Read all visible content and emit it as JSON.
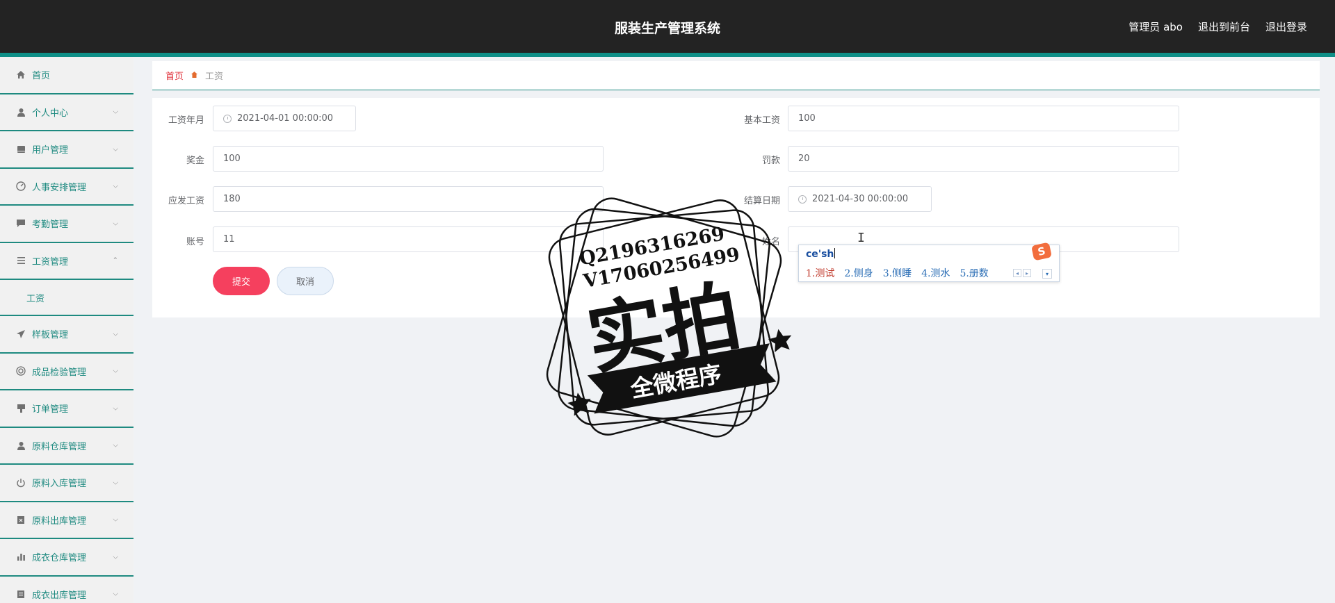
{
  "header": {
    "title": "服装生产管理系统",
    "links": [
      "管理员 abo",
      "退出到前台",
      "退出登录"
    ]
  },
  "sidebar": {
    "items": [
      {
        "label": "首页",
        "icon": "home-icon",
        "expandable": false
      },
      {
        "label": "个人中心",
        "icon": "user-icon",
        "expandable": true
      },
      {
        "label": "用户管理",
        "icon": "card-icon",
        "expandable": true
      },
      {
        "label": "人事安排管理",
        "icon": "gauge-icon",
        "expandable": true
      },
      {
        "label": "考勤管理",
        "icon": "chat-icon",
        "expandable": true
      },
      {
        "label": "工资管理",
        "icon": "list-icon",
        "expandable": true,
        "expanded": true
      },
      {
        "label": "样板管理",
        "icon": "send-icon",
        "expandable": true
      },
      {
        "label": "成品检验管理",
        "icon": "target-icon",
        "expandable": true
      },
      {
        "label": "订单管理",
        "icon": "stamp-icon",
        "expandable": true
      },
      {
        "label": "原料仓库管理",
        "icon": "person-icon",
        "expandable": true
      },
      {
        "label": "原料入库管理",
        "icon": "power-icon",
        "expandable": true
      },
      {
        "label": "原料出库管理",
        "icon": "clipboard-x-icon",
        "expandable": true
      },
      {
        "label": "成衣仓库管理",
        "icon": "bar-chart-icon",
        "expandable": true
      },
      {
        "label": "成衣出库管理",
        "icon": "clipboard-icon",
        "expandable": true
      }
    ],
    "sub_item": "工资"
  },
  "breadcrumb": {
    "home": "首页",
    "current": "工资"
  },
  "form": {
    "salary_month": {
      "label": "工资年月",
      "value": "2021-04-01 00:00:00"
    },
    "base_salary": {
      "label": "基本工资",
      "value": "100"
    },
    "bonus": {
      "label": "奖金",
      "value": "100"
    },
    "penalty": {
      "label": "罚款",
      "value": "20"
    },
    "payable": {
      "label": "应发工资",
      "value": "180"
    },
    "settle_date": {
      "label": "结算日期",
      "value": "2021-04-30 00:00:00"
    },
    "account": {
      "label": "账号",
      "value": "11"
    },
    "name": {
      "label": "姓名",
      "value": ""
    },
    "submit": "提交",
    "cancel": "取消"
  },
  "ime": {
    "composition": "ce'sh",
    "candidates": [
      "1.测试",
      "2.侧身",
      "3.侧睡",
      "4.测水",
      "5.册数"
    ],
    "logo": "S"
  },
  "watermark": {
    "line1": "Q2196316269",
    "line2": "V17060256499",
    "big": "实拍",
    "banner": "全微程序"
  },
  "colors": {
    "header_bg": "#232323",
    "accent_teal": "#1e8a80",
    "submit_red": "#f5405e",
    "breadcrumb_red": "#e0303a"
  }
}
